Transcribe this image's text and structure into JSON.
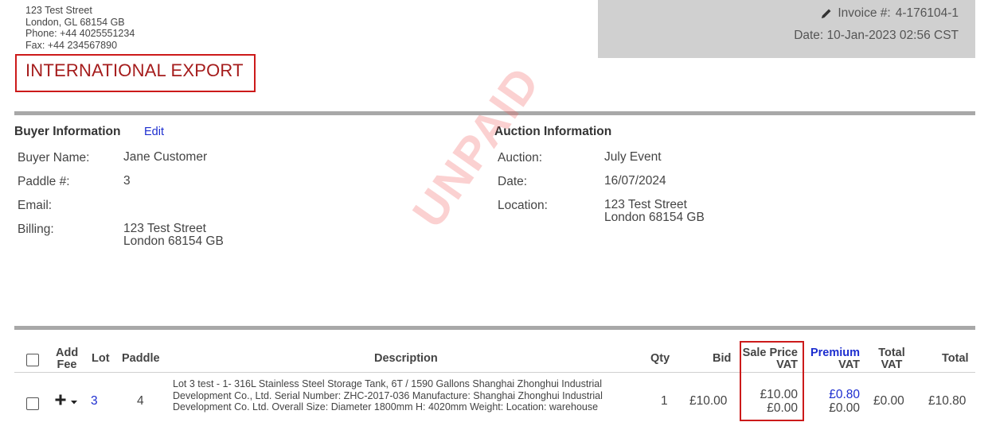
{
  "company": {
    "address_line1": "123 Test Street",
    "address_line2": "London, GL 68154 GB",
    "phone": "Phone: +44 4025551234",
    "fax": "Fax: +44 234567890"
  },
  "export_label": "INTERNATIONAL EXPORT",
  "invoice": {
    "number_label": "Invoice #:",
    "number": "4-176104-1",
    "date_label": "Date:",
    "date": "10-Jan-2023 02:56 CST"
  },
  "watermark": "UNPAID",
  "buyer": {
    "title": "Buyer Information",
    "edit_label": "Edit",
    "name_label": "Buyer Name:",
    "name": "Jane Customer",
    "paddle_label": "Paddle #:",
    "paddle": "3",
    "email_label": "Email:",
    "email": "",
    "billing_label": "Billing:",
    "billing_line1": "123 Test Street",
    "billing_line2": "London 68154 GB"
  },
  "auction": {
    "title": "Auction Information",
    "auction_label": "Auction:",
    "auction": "July Event",
    "date_label": "Date:",
    "date": "16/07/2024",
    "location_label": "Location:",
    "location_line1": "123 Test Street",
    "location_line2": "London 68154 GB"
  },
  "table": {
    "headers": {
      "add_fee_1": "Add",
      "add_fee_2": "Fee",
      "lot": "Lot",
      "paddle": "Paddle",
      "description": "Description",
      "qty": "Qty",
      "bid": "Bid",
      "sale_price_1": "Sale Price",
      "sale_price_2": "VAT",
      "premium_1": "Premium",
      "premium_2": "VAT",
      "total_vat_1": "Total",
      "total_vat_2": "VAT",
      "total": "Total"
    },
    "rows": [
      {
        "add_icon": "plus-dropdown-icon",
        "lot": "3",
        "paddle": "4",
        "description": "Lot 3 test - 1- 316L Stainless Steel Storage Tank, 6T / 1590 Gallons Shanghai Zhonghui Industrial Development Co., Ltd. Serial Number: ZHC-2017-036 Manufacture: Shanghai Zhonghui Industrial Development Co. Ltd. Overall Size: Diameter 1800mm H: 4020mm Weight: Location: warehouse",
        "qty": "1",
        "bid": "£10.00",
        "sale_price": "£10.00",
        "sale_vat": "£0.00",
        "premium": "£0.80",
        "premium_vat": "£0.00",
        "total_vat": "£0.00",
        "total": "£10.80"
      }
    ]
  },
  "icons": {
    "edit_invoice": "pencil-icon",
    "add_fee": "plus-icon",
    "dropdown": "caret-down-icon"
  }
}
